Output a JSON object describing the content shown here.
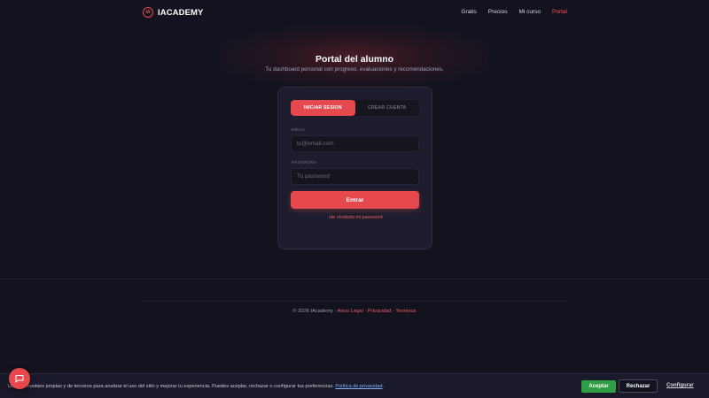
{
  "brand": {
    "logo_mark": "IA",
    "name": "IACADEMY"
  },
  "nav": {
    "items": [
      {
        "label": "Gratis"
      },
      {
        "label": "Precios"
      },
      {
        "label": "Mi curso"
      },
      {
        "label": "Portal",
        "active": true
      }
    ]
  },
  "hero": {
    "title": "Portal del alumno",
    "subtitle": "Tu dashboard personal con progreso, evaluaciones y recomendaciones."
  },
  "auth": {
    "tabs": [
      {
        "label": "INICIAR SESION",
        "active": true
      },
      {
        "label": "CREAR CUENTA",
        "active": false
      }
    ],
    "email_label": "EMAIL",
    "email_placeholder": "tu@email.com",
    "email_value": "",
    "password_label": "PASSWORD",
    "password_placeholder": "Tu password",
    "password_value": "",
    "submit_label": "Entrar",
    "forgot_label": "He olvidado mi password"
  },
  "footer": {
    "copyright": "© 2026 IAcademy · ",
    "links": [
      "Aviso Legal",
      "Privacidad",
      "Terminos"
    ],
    "separator": " · "
  },
  "cookies": {
    "text": "Usamos cookies propias y de terceros para analizar el uso del sitio y mejorar tu experiencia. Puedes aceptar, rechazar o configurar tus preferencias. ",
    "policy_link": "Política de privacidad",
    "text_end": ".",
    "accept_label": "Aceptar",
    "reject_label": "Rechazar",
    "config_label": "Configurar"
  },
  "colors": {
    "accent": "#e5484d",
    "background": "#13131f",
    "card": "#1d1d2d",
    "accept": "#2f9e44",
    "link": "#7fb0ff"
  },
  "icons": {
    "chat": "chat-icon"
  }
}
